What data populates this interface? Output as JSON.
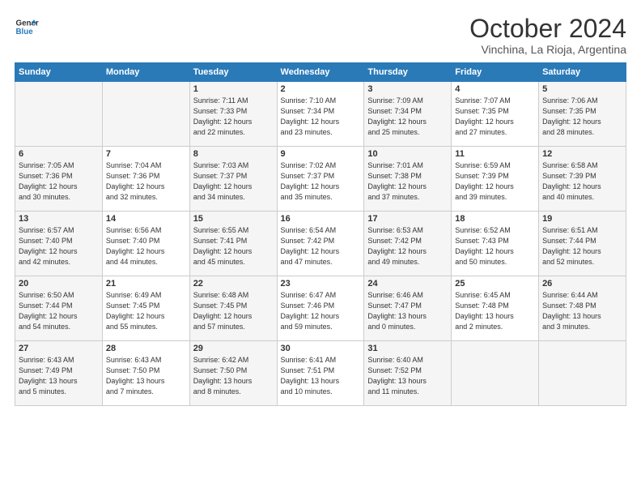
{
  "header": {
    "logo_line1": "General",
    "logo_line2": "Blue",
    "month": "October 2024",
    "location": "Vinchina, La Rioja, Argentina"
  },
  "days_of_week": [
    "Sunday",
    "Monday",
    "Tuesday",
    "Wednesday",
    "Thursday",
    "Friday",
    "Saturday"
  ],
  "weeks": [
    [
      {
        "day": "",
        "info": ""
      },
      {
        "day": "",
        "info": ""
      },
      {
        "day": "1",
        "info": "Sunrise: 7:11 AM\nSunset: 7:33 PM\nDaylight: 12 hours\nand 22 minutes."
      },
      {
        "day": "2",
        "info": "Sunrise: 7:10 AM\nSunset: 7:34 PM\nDaylight: 12 hours\nand 23 minutes."
      },
      {
        "day": "3",
        "info": "Sunrise: 7:09 AM\nSunset: 7:34 PM\nDaylight: 12 hours\nand 25 minutes."
      },
      {
        "day": "4",
        "info": "Sunrise: 7:07 AM\nSunset: 7:35 PM\nDaylight: 12 hours\nand 27 minutes."
      },
      {
        "day": "5",
        "info": "Sunrise: 7:06 AM\nSunset: 7:35 PM\nDaylight: 12 hours\nand 28 minutes."
      }
    ],
    [
      {
        "day": "6",
        "info": "Sunrise: 7:05 AM\nSunset: 7:36 PM\nDaylight: 12 hours\nand 30 minutes."
      },
      {
        "day": "7",
        "info": "Sunrise: 7:04 AM\nSunset: 7:36 PM\nDaylight: 12 hours\nand 32 minutes."
      },
      {
        "day": "8",
        "info": "Sunrise: 7:03 AM\nSunset: 7:37 PM\nDaylight: 12 hours\nand 34 minutes."
      },
      {
        "day": "9",
        "info": "Sunrise: 7:02 AM\nSunset: 7:37 PM\nDaylight: 12 hours\nand 35 minutes."
      },
      {
        "day": "10",
        "info": "Sunrise: 7:01 AM\nSunset: 7:38 PM\nDaylight: 12 hours\nand 37 minutes."
      },
      {
        "day": "11",
        "info": "Sunrise: 6:59 AM\nSunset: 7:39 PM\nDaylight: 12 hours\nand 39 minutes."
      },
      {
        "day": "12",
        "info": "Sunrise: 6:58 AM\nSunset: 7:39 PM\nDaylight: 12 hours\nand 40 minutes."
      }
    ],
    [
      {
        "day": "13",
        "info": "Sunrise: 6:57 AM\nSunset: 7:40 PM\nDaylight: 12 hours\nand 42 minutes."
      },
      {
        "day": "14",
        "info": "Sunrise: 6:56 AM\nSunset: 7:40 PM\nDaylight: 12 hours\nand 44 minutes."
      },
      {
        "day": "15",
        "info": "Sunrise: 6:55 AM\nSunset: 7:41 PM\nDaylight: 12 hours\nand 45 minutes."
      },
      {
        "day": "16",
        "info": "Sunrise: 6:54 AM\nSunset: 7:42 PM\nDaylight: 12 hours\nand 47 minutes."
      },
      {
        "day": "17",
        "info": "Sunrise: 6:53 AM\nSunset: 7:42 PM\nDaylight: 12 hours\nand 49 minutes."
      },
      {
        "day": "18",
        "info": "Sunrise: 6:52 AM\nSunset: 7:43 PM\nDaylight: 12 hours\nand 50 minutes."
      },
      {
        "day": "19",
        "info": "Sunrise: 6:51 AM\nSunset: 7:44 PM\nDaylight: 12 hours\nand 52 minutes."
      }
    ],
    [
      {
        "day": "20",
        "info": "Sunrise: 6:50 AM\nSunset: 7:44 PM\nDaylight: 12 hours\nand 54 minutes."
      },
      {
        "day": "21",
        "info": "Sunrise: 6:49 AM\nSunset: 7:45 PM\nDaylight: 12 hours\nand 55 minutes."
      },
      {
        "day": "22",
        "info": "Sunrise: 6:48 AM\nSunset: 7:45 PM\nDaylight: 12 hours\nand 57 minutes."
      },
      {
        "day": "23",
        "info": "Sunrise: 6:47 AM\nSunset: 7:46 PM\nDaylight: 12 hours\nand 59 minutes."
      },
      {
        "day": "24",
        "info": "Sunrise: 6:46 AM\nSunset: 7:47 PM\nDaylight: 13 hours\nand 0 minutes."
      },
      {
        "day": "25",
        "info": "Sunrise: 6:45 AM\nSunset: 7:48 PM\nDaylight: 13 hours\nand 2 minutes."
      },
      {
        "day": "26",
        "info": "Sunrise: 6:44 AM\nSunset: 7:48 PM\nDaylight: 13 hours\nand 3 minutes."
      }
    ],
    [
      {
        "day": "27",
        "info": "Sunrise: 6:43 AM\nSunset: 7:49 PM\nDaylight: 13 hours\nand 5 minutes."
      },
      {
        "day": "28",
        "info": "Sunrise: 6:43 AM\nSunset: 7:50 PM\nDaylight: 13 hours\nand 7 minutes."
      },
      {
        "day": "29",
        "info": "Sunrise: 6:42 AM\nSunset: 7:50 PM\nDaylight: 13 hours\nand 8 minutes."
      },
      {
        "day": "30",
        "info": "Sunrise: 6:41 AM\nSunset: 7:51 PM\nDaylight: 13 hours\nand 10 minutes."
      },
      {
        "day": "31",
        "info": "Sunrise: 6:40 AM\nSunset: 7:52 PM\nDaylight: 13 hours\nand 11 minutes."
      },
      {
        "day": "",
        "info": ""
      },
      {
        "day": "",
        "info": ""
      }
    ]
  ]
}
